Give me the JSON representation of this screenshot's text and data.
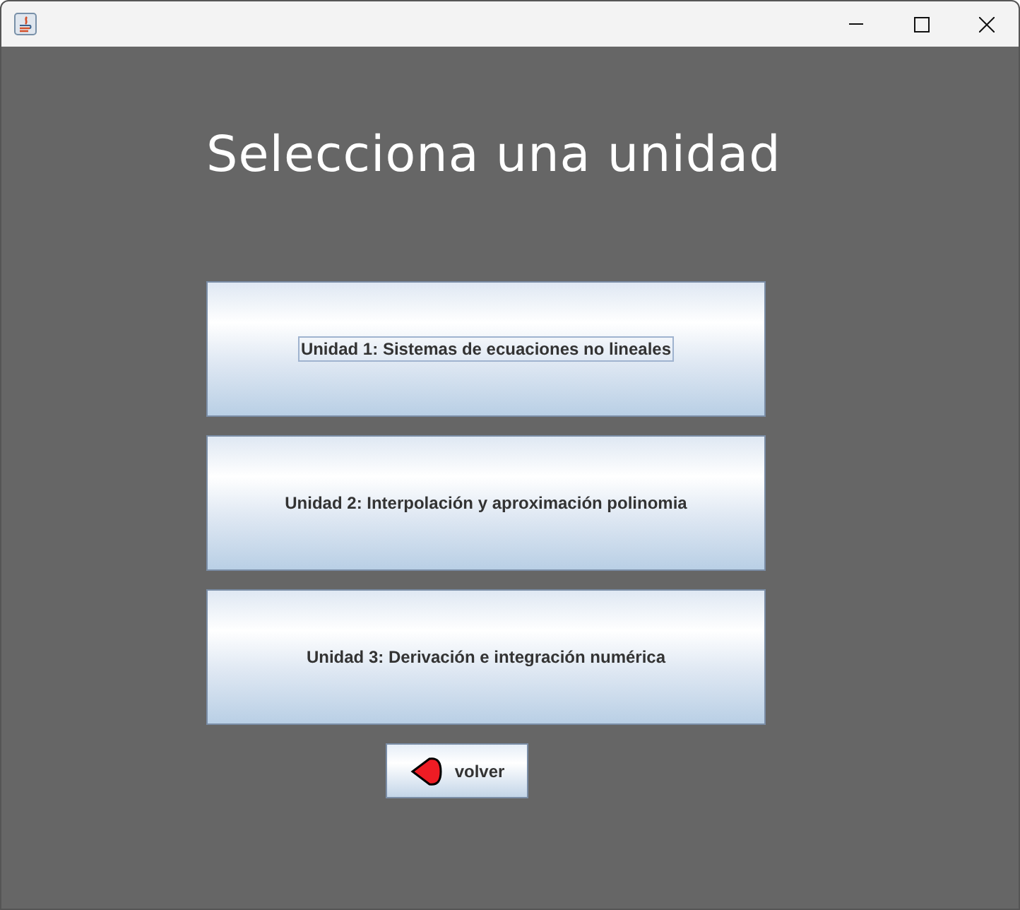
{
  "heading": "Selecciona una unidad",
  "units": [
    {
      "label": "Unidad 1: Sistemas de ecuaciones no lineales",
      "focused": true
    },
    {
      "label": "Unidad 2: Interpolación y aproximación polinomia",
      "focused": false
    },
    {
      "label": "Unidad 3: Derivación e integración numérica",
      "focused": false
    }
  ],
  "back_button": {
    "label": "volver"
  }
}
